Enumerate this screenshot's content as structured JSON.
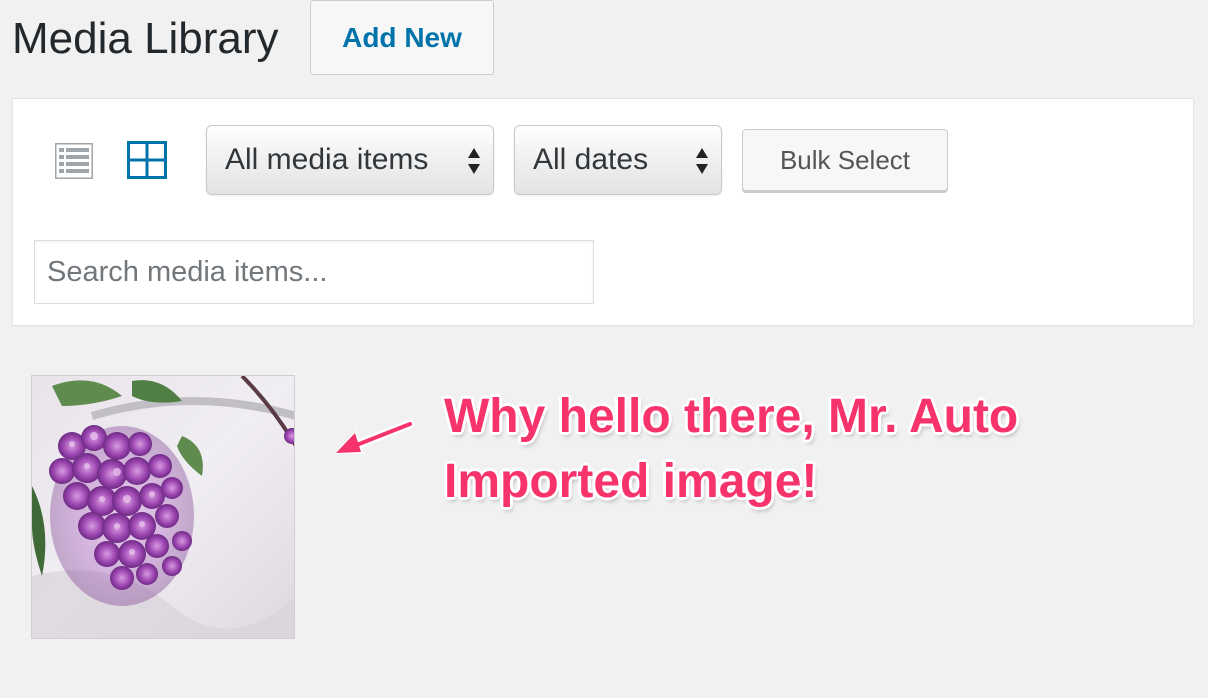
{
  "header": {
    "title": "Media Library",
    "add_new_label": "Add New"
  },
  "toolbar": {
    "type_filter": {
      "selected": "All media items"
    },
    "date_filter": {
      "selected": "All dates"
    },
    "bulk_select_label": "Bulk Select",
    "search": {
      "placeholder": "Search media items..."
    },
    "icons": {
      "list_view": "list-view-icon",
      "grid_view": "grid-view-icon"
    }
  },
  "media": {
    "items": [
      {
        "subject": "lilac-flower-photo"
      }
    ]
  },
  "annotation": {
    "line1": "Why hello there, Mr. Auto",
    "line2": "Imported image!",
    "color": "#f6336b"
  },
  "colors": {
    "accent": "#0073aa",
    "background": "#f1f1f1",
    "annotation": "#f6336b"
  }
}
